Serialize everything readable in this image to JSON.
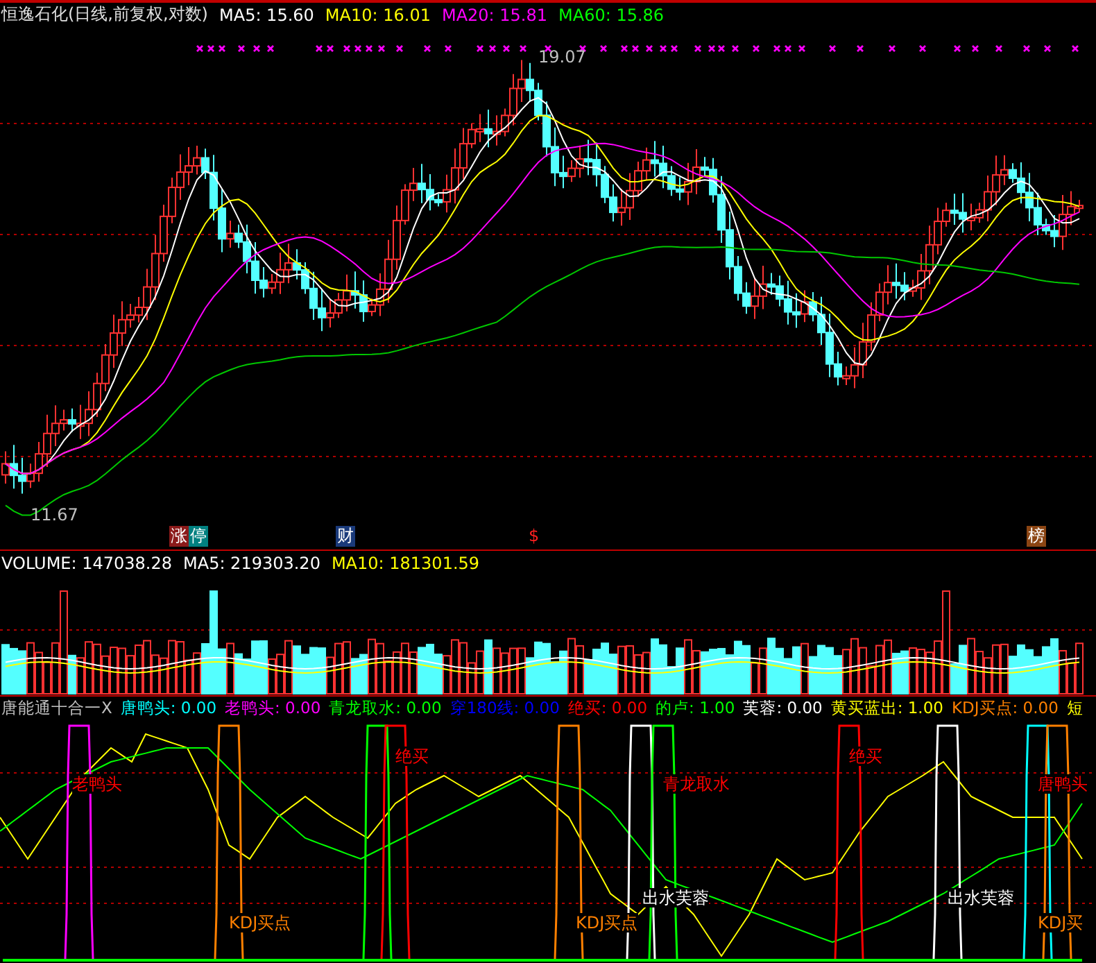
{
  "price_panel": {
    "title": "恒逸石化(日线,前复权,对数)",
    "moving_averages": [
      {
        "label": "MA5: 15.60",
        "color": "#ffffff"
      },
      {
        "label": "MA10: 16.01",
        "color": "#ffff00"
      },
      {
        "label": "MA20: 15.81",
        "color": "#ff00ff"
      },
      {
        "label": "MA60: 15.86",
        "color": "#00ff00"
      }
    ],
    "high_label": "19.07",
    "low_label": "11.67",
    "event_markers": [
      {
        "label": "涨",
        "color": "#8b1a1a"
      },
      {
        "label": "停",
        "color": "#008080"
      },
      {
        "label": "财",
        "color": "#1a3a7a"
      },
      {
        "label": "$",
        "color": "#000000"
      },
      {
        "label": "榜",
        "color": "#8b4513"
      }
    ]
  },
  "volume_panel": {
    "items": [
      {
        "label": "VOLUME: 147038.28",
        "color": "#ffffff"
      },
      {
        "label": "MA5: 219303.20",
        "color": "#ffffff"
      },
      {
        "label": "MA10: 181301.59",
        "color": "#ffff00"
      }
    ]
  },
  "indicator_panel": {
    "items": [
      {
        "label": "唐能通十合一X",
        "color": "#c0c0c0"
      },
      {
        "label": "唐鸭头: 0.00",
        "color": "#00ffff"
      },
      {
        "label": "老鸭头: 0.00",
        "color": "#ff00ff"
      },
      {
        "label": "青龙取水: 0.00",
        "color": "#00ff00"
      },
      {
        "label": "穿180线: 0.00",
        "color": "#0000ff"
      },
      {
        "label": "绝买: 0.00",
        "color": "#ff0000"
      },
      {
        "label": "的卢: 1.00",
        "color": "#00ff00"
      },
      {
        "label": "芙蓉: 0.00",
        "color": "#ffffff"
      },
      {
        "label": "黄买蓝出: 1.00",
        "color": "#ffff00"
      },
      {
        "label": "KDJ买点: 0.00",
        "color": "#ff8000"
      },
      {
        "label": "短",
        "color": "#ffff00"
      }
    ],
    "signal_labels": [
      {
        "text": "老鸭头",
        "color": "#ff0000"
      },
      {
        "text": "绝买",
        "color": "#ff0000"
      },
      {
        "text": "青龙取水",
        "color": "#ff0000"
      },
      {
        "text": "绝买",
        "color": "#ff0000"
      },
      {
        "text": "唐鸭头",
        "color": "#ff0000"
      },
      {
        "text": "KDJ买点",
        "color": "#ff8000"
      },
      {
        "text": "KDJ买点",
        "color": "#ff8000"
      },
      {
        "text": "出水芙蓉",
        "color": "#ffffff"
      },
      {
        "text": "出水芙蓉",
        "color": "#ffffff"
      },
      {
        "text": "KDJ买",
        "color": "#ff8000"
      }
    ]
  }
}
